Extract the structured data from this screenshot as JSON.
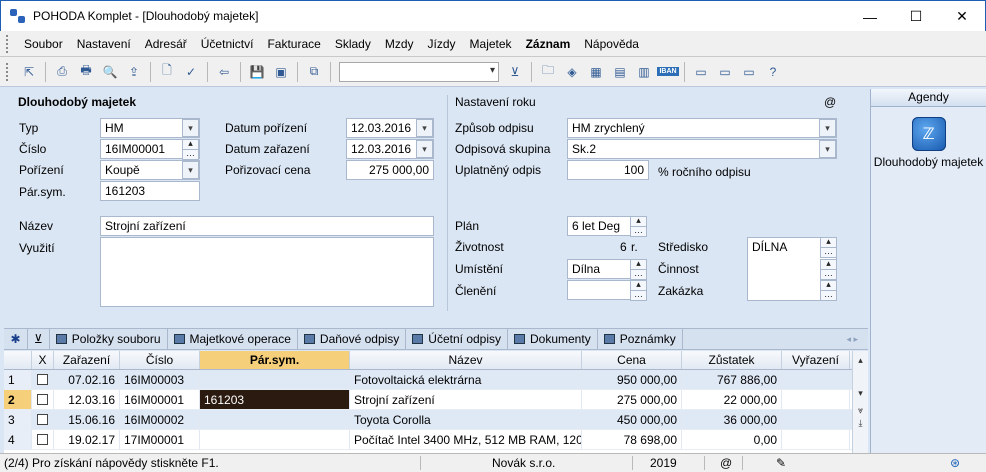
{
  "window": {
    "title": "POHODA Komplet - [Dlouhodobý majetek]",
    "minimize": "—",
    "maximize": "☐",
    "close": "✕"
  },
  "menu": [
    "Soubor",
    "Nastavení",
    "Adresář",
    "Účetnictví",
    "Fakturace",
    "Sklady",
    "Mzdy",
    "Jízdy",
    "Majetek",
    "Záznam",
    "Nápověda"
  ],
  "toolbar": {
    "iban_label": "IBAN"
  },
  "form": {
    "section_title": "Dlouhodobý majetek",
    "typ_label": "Typ",
    "typ_value": "HM",
    "cislo_label": "Číslo",
    "cislo_value": "16IM00001",
    "porizeni_label": "Pořízení",
    "porizeni_value": "Koupě",
    "parsym_label": "Pár.sym.",
    "parsym_value": "161203",
    "datum_porizeni_label": "Datum pořízení",
    "datum_porizeni_value": "12.03.2016",
    "datum_zarazeni_label": "Datum zařazení",
    "datum_zarazeni_value": "12.03.2016",
    "porizovaci_cena_label": "Pořizovací cena",
    "porizovaci_cena_value": "275 000,00",
    "nazev_label": "Název",
    "nazev_value": "Strojní zařízení",
    "vyuziti_label": "Využití",
    "settings_title": "Nastavení roku",
    "at_sign": "@",
    "zpusob_label": "Způsob odpisu",
    "zpusob_value": "HM zrychlený",
    "skupina_label": "Odpisová skupina",
    "skupina_value": "Sk.2",
    "uplatneny_label": "Uplatněný odpis",
    "uplatneny_value": "100",
    "uplatneny_unit": "% ročního odpisu",
    "plan_label": "Plán",
    "plan_value": "6 let Deg",
    "zivotnost_label": "Životnost",
    "zivotnost_value": "6",
    "zivotnost_unit": "r.",
    "umisteni_label": "Umístění",
    "umisteni_value": "Dílna",
    "cleneni_label": "Členění",
    "stredisko_label": "Středisko",
    "stredisko_value": "DÍLNA",
    "cinnost_label": "Činnost",
    "zakazka_label": "Zakázka"
  },
  "agendy": {
    "title": "Agendy",
    "item_label": "Dlouhodobý majetek"
  },
  "tabs": [
    "Položky souboru",
    "Majetkové operace",
    "Daňové odpisy",
    "Účetní odpisy",
    "Dokumenty",
    "Poznámky"
  ],
  "table": {
    "headers": {
      "x": "X",
      "zarazeni": "Zařazení",
      "cislo": "Číslo",
      "parsym": "Pár.sym.",
      "nazev": "Název",
      "cena": "Cena",
      "zustatek": "Zůstatek",
      "vyrazeni": "Vyřazení"
    },
    "rows": [
      {
        "idx": "1",
        "zarazeni": "07.02.16",
        "cislo": "16IM00003",
        "parsym": "",
        "nazev": "Fotovoltaická elektrárna",
        "cena": "950 000,00",
        "zustatek": "767 886,00",
        "vyrazeni": ""
      },
      {
        "idx": "2",
        "zarazeni": "12.03.16",
        "cislo": "16IM00001",
        "parsym": "161203",
        "nazev": "Strojní zařízení",
        "cena": "275 000,00",
        "zustatek": "22 000,00",
        "vyrazeni": ""
      },
      {
        "idx": "3",
        "zarazeni": "15.06.16",
        "cislo": "16IM00002",
        "parsym": "",
        "nazev": "Toyota Corolla",
        "cena": "450 000,00",
        "zustatek": "36 000,00",
        "vyrazeni": ""
      },
      {
        "idx": "4",
        "zarazeni": "19.02.17",
        "cislo": "17IM00001",
        "parsym": "",
        "nazev": "Počítač Intel 3400 MHz, 512 MB RAM, 120",
        "cena": "78 698,00",
        "zustatek": "0,00",
        "vyrazeni": ""
      }
    ]
  },
  "status": {
    "record": "(2/4) Pro získání nápovědy stiskněte F1.",
    "company": "Novák s.r.o.",
    "year": "2019",
    "at": "@"
  }
}
